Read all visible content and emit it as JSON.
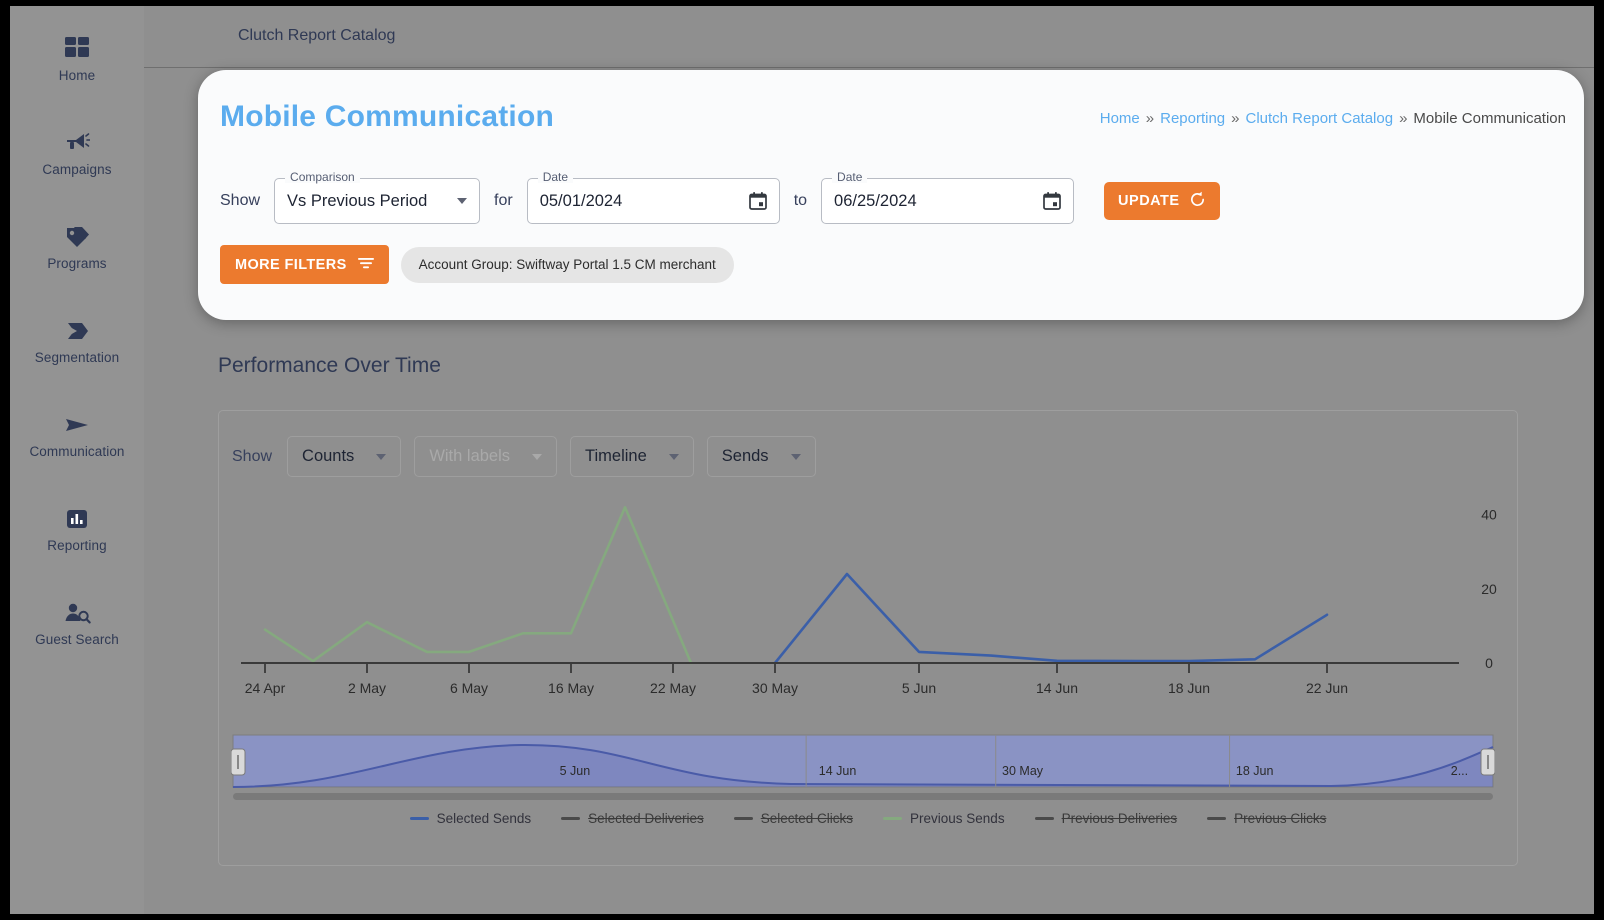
{
  "app": {
    "topbar_title": "Clutch Report Catalog"
  },
  "sidebar": {
    "items": [
      {
        "label": "Home",
        "icon": "grid-icon"
      },
      {
        "label": "Campaigns",
        "icon": "megaphone-icon"
      },
      {
        "label": "Programs",
        "icon": "tag-icon"
      },
      {
        "label": "Segmentation",
        "icon": "segment-icon"
      },
      {
        "label": "Communication",
        "icon": "paper-plane-icon"
      },
      {
        "label": "Reporting",
        "icon": "bar-chart-icon"
      },
      {
        "label": "Guest Search",
        "icon": "user-search-icon"
      }
    ]
  },
  "header": {
    "title": "Mobile Communication",
    "title_color": "#5bacee",
    "breadcrumb": [
      {
        "label": "Home",
        "link": true
      },
      {
        "label": "Reporting",
        "link": true
      },
      {
        "label": "Clutch Report Catalog",
        "link": true
      },
      {
        "label": "Mobile Communication",
        "link": false
      }
    ],
    "separator": "»"
  },
  "filters": {
    "show_label": "Show",
    "comparison": {
      "legend": "Comparison",
      "value": "Vs Previous Period"
    },
    "for_label": "for",
    "date_from": {
      "legend": "Date",
      "value": "05/01/2024"
    },
    "to_label": "to",
    "date_to": {
      "legend": "Date",
      "value": "06/25/2024"
    },
    "update_label": "UPDATE",
    "more_filters_label": "MORE FILTERS",
    "account_chip": "Account Group: Swiftway Portal 1.5 CM merchant",
    "accent_color": "#ec7a2e"
  },
  "report": {
    "section_title": "Performance Over Time",
    "controls": {
      "show_label": "Show",
      "metric_type": {
        "value": "Counts",
        "disabled": false
      },
      "labels": {
        "value": "With labels",
        "disabled": true
      },
      "view": {
        "value": "Timeline",
        "disabled": false
      },
      "measure": {
        "value": "Sends",
        "disabled": false
      }
    }
  },
  "chart_data": {
    "type": "line",
    "title": "Performance Over Time",
    "xlabel": "",
    "ylabel": "",
    "ylim": [
      0,
      48
    ],
    "yticks": [
      0,
      20,
      40
    ],
    "ytick_labels": [
      "0",
      "20",
      "40"
    ],
    "y_axis_position": "right",
    "grid": false,
    "legend_position": "bottom",
    "xticks": [
      "24 Apr",
      "2 May",
      "6 May",
      "16 May",
      "22 May",
      "30 May",
      "5 Jun",
      "14 Jun",
      "18 Jun",
      "22 Jun"
    ],
    "xtick_positions": [
      0.02,
      0.105,
      0.19,
      0.275,
      0.36,
      0.445,
      0.565,
      0.68,
      0.79,
      0.905
    ],
    "series": [
      {
        "name": "Selected Sends",
        "color": "#3b5fa8",
        "visible": true,
        "points": [
          {
            "x": 0.445,
            "y": 0
          },
          {
            "x": 0.505,
            "y": 24
          },
          {
            "x": 0.565,
            "y": 3
          },
          {
            "x": 0.625,
            "y": 2
          },
          {
            "x": 0.68,
            "y": 0.6
          },
          {
            "x": 0.79,
            "y": 0.5
          },
          {
            "x": 0.845,
            "y": 1
          },
          {
            "x": 0.905,
            "y": 13
          }
        ]
      },
      {
        "name": "Selected Deliveries",
        "color": "#4a4a4a",
        "visible": false,
        "points": []
      },
      {
        "name": "Selected Clicks",
        "color": "#4a4a4a",
        "visible": false,
        "points": []
      },
      {
        "name": "Previous Sends",
        "color": "#85a97f",
        "visible": true,
        "points": [
          {
            "x": 0.02,
            "y": 9
          },
          {
            "x": 0.06,
            "y": 0.5
          },
          {
            "x": 0.105,
            "y": 11
          },
          {
            "x": 0.155,
            "y": 3
          },
          {
            "x": 0.19,
            "y": 3
          },
          {
            "x": 0.235,
            "y": 8
          },
          {
            "x": 0.275,
            "y": 8
          },
          {
            "x": 0.32,
            "y": 42
          },
          {
            "x": 0.375,
            "y": 0
          }
        ]
      },
      {
        "name": "Previous Deliveries",
        "color": "#4a4a4a",
        "visible": false,
        "points": []
      },
      {
        "name": "Previous Clicks",
        "color": "#4a4a4a",
        "visible": false,
        "points": []
      }
    ],
    "range_slider": {
      "labels": [
        "5 Jun",
        "14 Jun",
        "30 May",
        "18 Jun",
        "2..."
      ],
      "label_positions": [
        0.26,
        0.465,
        0.61,
        0.795,
        0.965
      ],
      "fill_color": "#8a93c4",
      "line_color": "#4a5ba8",
      "selection_start": 0.0,
      "selection_end": 1.0
    }
  }
}
